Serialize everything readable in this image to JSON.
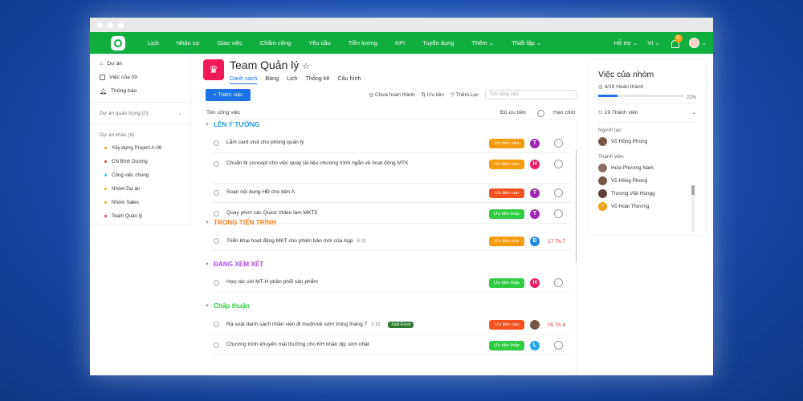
{
  "nav": {
    "items": [
      "Lịch",
      "Nhân sự",
      "Giao việc",
      "Chấm công",
      "Yêu cầu",
      "Tiền lương",
      "KPI",
      "Tuyển dụng",
      "Thêm",
      "Thiết lập"
    ],
    "help": "Hỗ trợ",
    "lang": "VI",
    "notif_count": "8"
  },
  "sidebar": {
    "items": [
      "Dự án",
      "Việc của tôi",
      "Thông báo"
    ],
    "important": "Dự án quan trọng (0)",
    "other": "Dự án khác (6)",
    "projects": [
      {
        "name": "Xây dựng Project A-06",
        "color": "#f5a623"
      },
      {
        "name": "CN Bình Dương",
        "color": "#e53935"
      },
      {
        "name": "Công việc chung",
        "color": "#29b6f6"
      },
      {
        "name": "Nhóm Dự án",
        "color": "#f5a623"
      },
      {
        "name": "Nhóm Sales",
        "color": "#f5a623"
      },
      {
        "name": "Team Quản lý",
        "color": "#e53935"
      }
    ]
  },
  "main": {
    "title": "Team Quản lý",
    "tabs": [
      "Danh sách",
      "Bảng",
      "Lịch",
      "Thống kê",
      "Cấu hình"
    ],
    "add_button": "+ Thêm việc",
    "filters": [
      "Chưa hoàn thành",
      "Ưu tiên",
      "Thêm Lọc"
    ],
    "search_placeholder": "Tìm công việc",
    "col_name": "Tên công việc",
    "col_priority": "Độ ưu tiên",
    "col_due": "Hạn chót"
  },
  "groups": [
    {
      "name": "LÊN Ý TƯỞNG",
      "color": "#1a9be8",
      "tasks": [
        {
          "name": "Lắm card visit cho phòng quản lý",
          "sub": "",
          "priority": "Ưu tiên vừa",
          "pcolor": "#f59b0c",
          "avatar": "T",
          "acolor": "#9c27b0",
          "due": ""
        },
        {
          "name": "Chuẩn bị concept cho việc quay tài liệu chương trình ngắn về hoạt động MTK",
          "sub": "",
          "priority": "Ưu tiên vừa",
          "pcolor": "#f59b0c",
          "avatar": "H",
          "acolor": "#e91e63",
          "due": ""
        },
        {
          "name": "Soạn nội dung HĐ cho bên A",
          "sub": "",
          "priority": "Ưu tiên cao",
          "pcolor": "#f4511e",
          "avatar": "T",
          "acolor": "#9c27b0",
          "due": ""
        },
        {
          "name": "Quay phim các Quick Video làm MKT5",
          "sub": "",
          "priority": "Ưu tiên thấp",
          "pcolor": "#2ecc40",
          "avatar": "T",
          "acolor": "#9c27b0",
          "due": ""
        }
      ]
    },
    {
      "name": "TRONG TIẾN TRÌNH",
      "color": "#f5841f",
      "tasks": [
        {
          "name": "Triển khai hoạt động MKT cho phiên bản mới của App",
          "sub": "6",
          "priority": "Ưu tiên vừa",
          "pcolor": "#f59b0c",
          "avatar": "Đ",
          "acolor": "#1e88e5",
          "due": "17 Th.7"
        }
      ]
    },
    {
      "name": "ĐANG XEM XÉT",
      "color": "#a64ee0",
      "tasks": [
        {
          "name": "Hợp tác với MT-H phân phối sản phẩm",
          "sub": "",
          "priority": "Ưu tiên thấp",
          "pcolor": "#2ecc40",
          "avatar": "H",
          "acolor": "#e91e63",
          "due": ""
        }
      ]
    },
    {
      "name": "Chấp thuận",
      "color": "#2ecc40",
      "tasks": [
        {
          "name": "Rà soát danh sách nhân viên đi muộn/về sớm trong tháng 7",
          "sub": "2",
          "tag": "Xuất Excel",
          "priority": "Ưu tiên cao",
          "pcolor": "#f4511e",
          "avatar": "",
          "acolor": "#795548",
          "due": "05 Th.8"
        },
        {
          "name": "Chương trình khuyến mãi thưởng cho KH nhân dịp sinh nhật",
          "sub": "",
          "priority": "Ưu tiên thấp",
          "pcolor": "#2ecc40",
          "avatar": "L",
          "acolor": "#26a5e4",
          "due": ""
        }
      ]
    }
  ],
  "panel": {
    "title": "Việc của nhóm",
    "done": "4/19 Hoàn thành",
    "percent": "22%",
    "progress": 0.22,
    "members_count": "19 Thành viên",
    "creator_label": "Người tạo",
    "creator": "Võ Hồng Phong",
    "members_label": "Thành viên",
    "members": [
      {
        "name": "Hứa Phương Nam",
        "color": "#8d6e63",
        "initial": ""
      },
      {
        "name": "Vũ Hồng Phong",
        "color": "#795548",
        "initial": ""
      },
      {
        "name": "Trương Việt Hùngg",
        "color": "#5d4037",
        "initial": ""
      },
      {
        "name": "Võ Hoài Thương",
        "color": "#f59b0c",
        "initial": "V"
      }
    ]
  }
}
